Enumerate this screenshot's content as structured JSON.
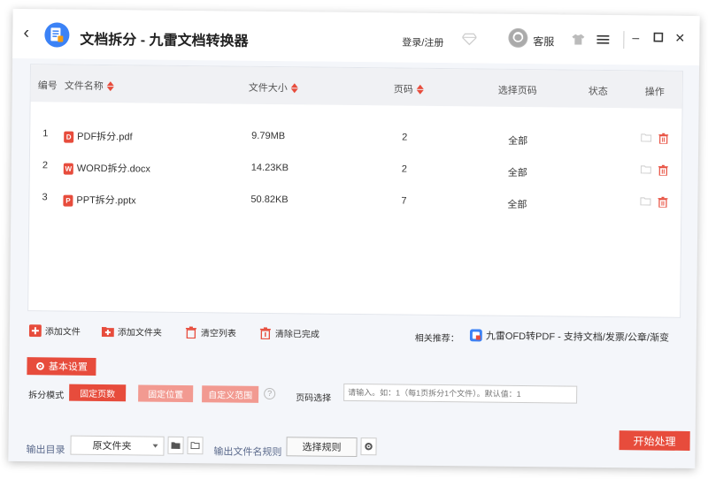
{
  "titlebar": {
    "title": "文档拆分 - 九雷文档转换器",
    "login": "登录/注册",
    "customer_service": "客服"
  },
  "table": {
    "headers": {
      "index": "编号",
      "name": "文件名称",
      "size": "文件大小",
      "pages": "页码",
      "select_pages": "选择页码",
      "status": "状态",
      "actions": "操作"
    },
    "rows": [
      {
        "index": "1",
        "name": "PDF拆分.pdf",
        "size": "9.79MB",
        "pages": "2",
        "select": "全部",
        "status": "",
        "icon_color": "#e74c3c",
        "icon_letter": "D"
      },
      {
        "index": "2",
        "name": "WORD拆分.docx",
        "size": "14.23KB",
        "pages": "2",
        "select": "全部",
        "status": "",
        "icon_color": "#e74c3c",
        "icon_letter": "W"
      },
      {
        "index": "3",
        "name": "PPT拆分.pptx",
        "size": "50.82KB",
        "pages": "7",
        "select": "全部",
        "status": "",
        "icon_color": "#e74c3c",
        "icon_letter": "P"
      }
    ]
  },
  "actions": {
    "add_file": "添加文件",
    "add_folder": "添加文件夹",
    "clear_list": "清空列表",
    "clear_done": "清除已完成",
    "recommend_label": "相关推荐：",
    "recommend_link": "九雷OFD转PDF - 支持文档/发票/公章/渐变"
  },
  "settings": {
    "basic_settings": "基本设置",
    "split_mode_label": "拆分模式",
    "mode_fixed_pages": "固定页数",
    "mode_fixed_position": "固定位置",
    "mode_custom_range": "自定义范围",
    "page_select_label": "页码选择",
    "page_select_placeholder": "请输入。如：1（每1页拆分1个文件）。默认值：1"
  },
  "output": {
    "dir_label": "输出目录",
    "dir_value": "原文件夹",
    "rule_label": "输出文件名规则",
    "rule_button": "选择规则",
    "start_button": "开始处理"
  },
  "colors": {
    "accent": "#e74c3c",
    "accent_light": "#f29a91",
    "link_blue": "#5b6a8c"
  }
}
